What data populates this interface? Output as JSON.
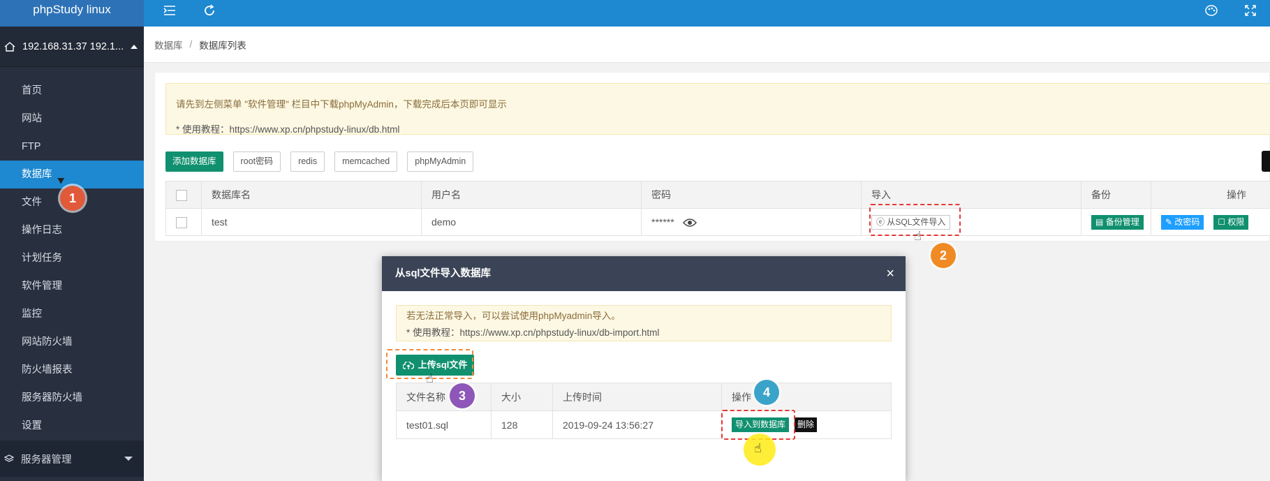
{
  "app_title": "phpStudy linux",
  "server": {
    "label": "192.168.31.37 192.1..."
  },
  "menu": [
    {
      "label": "首页"
    },
    {
      "label": "网站"
    },
    {
      "label": "FTP"
    },
    {
      "label": "数据库"
    },
    {
      "label": "文件"
    },
    {
      "label": "操作日志"
    },
    {
      "label": "计划任务"
    },
    {
      "label": "软件管理"
    },
    {
      "label": "监控"
    },
    {
      "label": "网站防火墙"
    },
    {
      "label": "防火墙报表"
    },
    {
      "label": "服务器防火墙"
    },
    {
      "label": "设置"
    }
  ],
  "active_menu": "数据库",
  "bottom_group": {
    "label": "服务器管理"
  },
  "breadcrumb": {
    "parent": "数据库",
    "separator": "/",
    "current": "数据库列表"
  },
  "notice": {
    "line1": "请先到左侧菜单 \"软件管理\" 栏目中下载phpMyAdmin，下载完成后本页即可显示",
    "line2": "* 使用教程：https://www.xp.cn/phpstudy-linux/db.html"
  },
  "toolbar": {
    "add": "添加数据库",
    "root_pwd": "root密码",
    "redis": "redis",
    "memcached": "memcached",
    "phpmyadmin": "phpMyAdmin"
  },
  "db_table": {
    "headers": [
      "数据库名",
      "用户名",
      "密码",
      "导入",
      "备份",
      "操作"
    ],
    "rows": [
      {
        "name": "test",
        "user": "demo",
        "password": "******",
        "import": "从SQL文件导入",
        "backup": "备份管理",
        "op_pwd": "改密码",
        "op_perm": "权限"
      }
    ]
  },
  "modal": {
    "title": "从sql文件导入数据库",
    "close": "×",
    "notice_line1": "若无法正常导入，可以尝试使用phpMyadmin导入。",
    "notice_line2": "* 使用教程：https://www.xp.cn/phpstudy-linux/db-import.html",
    "upload_label": "上传sql文件",
    "headers": [
      "文件名称",
      "大小",
      "上传时间",
      "操作"
    ],
    "rows": [
      {
        "filename": "test01.sql",
        "size": "128",
        "time": "2019-09-24 13:56:27",
        "import": "导入到数据库",
        "delete": "删除"
      }
    ]
  },
  "steps": [
    "1",
    "2",
    "3",
    "4"
  ],
  "colors": {
    "sidebar": "#28303f",
    "primary_blue": "#1e88d0",
    "green": "#10906f",
    "step1": "#e05a3a",
    "step2": "#f08a24",
    "step3": "#8e56b8",
    "step4": "#3aa3c9"
  },
  "icons": [
    "home-icon",
    "menu-fold-icon",
    "refresh-icon",
    "palette-icon",
    "fullscreen-icon",
    "eye-icon",
    "upload-cloud-icon",
    "close-icon",
    "pointer-hand-icon"
  ]
}
